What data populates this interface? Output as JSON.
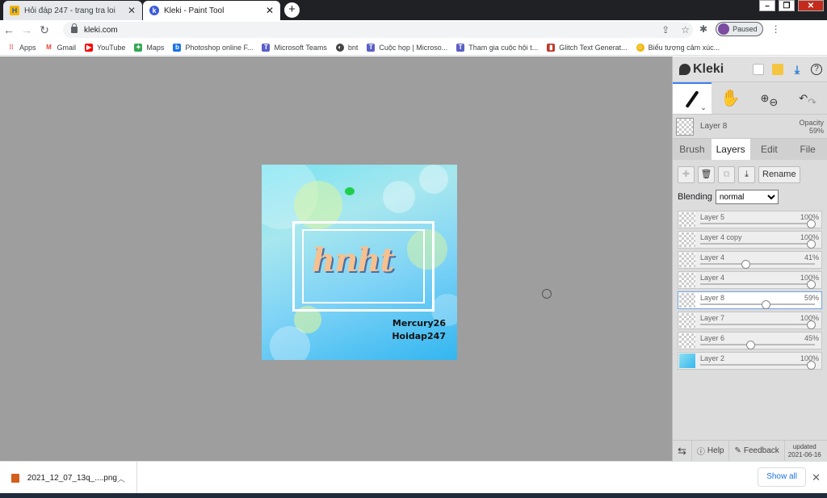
{
  "browser": {
    "tabs": [
      {
        "title": "Hỏi đáp 247 - trang tra loi",
        "favicon": "H"
      },
      {
        "title": "Kleki - Paint Tool",
        "favicon": "k"
      }
    ],
    "new_tab": "+",
    "url": "kleki.com",
    "profile_label": "Paused",
    "bookmarks": [
      "Apps",
      "Gmail",
      "YouTube",
      "Maps",
      "Photoshop online F...",
      "Microsoft Teams",
      "bnt",
      "Cuộc họp | Microso...",
      "Tham gia cuộc hội t...",
      "Glitch Text Generat...",
      "Biểu tượng cảm xúc..."
    ]
  },
  "artwork": {
    "lettering": "hnht",
    "credit_line1": "Mercury26",
    "credit_line2": "Hoidap247"
  },
  "kleki": {
    "logo": "Kleki",
    "current_layer": {
      "name": "Layer 8",
      "opacity_label": "Opacity",
      "opacity": "59%"
    },
    "tabs": [
      "Brush",
      "Layers",
      "Edit",
      "File"
    ],
    "active_tab": "Layers",
    "rename_label": "Rename",
    "blending_label": "Blending",
    "blending_value": "normal",
    "layers": [
      {
        "name": "Layer 5",
        "opacity": "100%",
        "value": 1.0
      },
      {
        "name": "Layer 4 copy",
        "opacity": "100%",
        "value": 1.0
      },
      {
        "name": "Layer 4",
        "opacity": "41%",
        "value": 0.41
      },
      {
        "name": "Layer 4",
        "opacity": "100%",
        "value": 1.0
      },
      {
        "name": "Layer 8",
        "opacity": "59%",
        "value": 0.59,
        "selected": true
      },
      {
        "name": "Layer 7",
        "opacity": "100%",
        "value": 1.0
      },
      {
        "name": "Layer 6",
        "opacity": "45%",
        "value": 0.45
      },
      {
        "name": "Layer 2",
        "opacity": "100%",
        "value": 1.0
      }
    ],
    "footer": {
      "help": "Help",
      "feedback": "Feedback",
      "updated_label": "updated",
      "updated_date": "2021-06-16"
    }
  },
  "downloads": {
    "file": "2021_12_07_13q_....png",
    "show_all": "Show all"
  }
}
